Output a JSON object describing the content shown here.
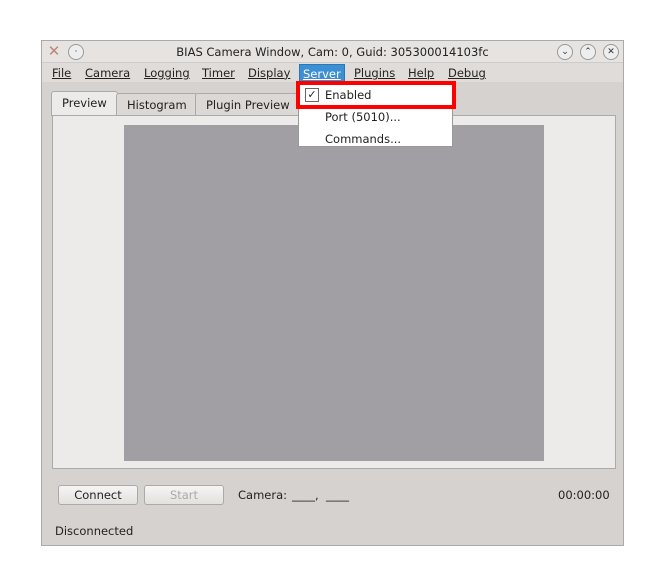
{
  "window": {
    "title": "BIAS Camera Window, Cam: 0, Guid: 305300014103fc"
  },
  "menubar": {
    "items": [
      "File",
      "Camera",
      "Logging",
      "Timer",
      "Display",
      "Server",
      "Plugins",
      "Help",
      "Debug"
    ],
    "active": "Server"
  },
  "server_menu": {
    "items": [
      {
        "label": "Enabled",
        "checked": true
      },
      {
        "label": "Port (5010)..."
      },
      {
        "label": "Commands..."
      }
    ]
  },
  "tabs": [
    {
      "label": "Preview",
      "selected": true
    },
    {
      "label": "Histogram"
    },
    {
      "label": "Plugin Preview"
    }
  ],
  "controls": {
    "connect": "Connect",
    "start": "Start",
    "camera_label": "Camera:",
    "camera_value": "____,  ____",
    "timer": "00:00:00"
  },
  "status": "Disconnected",
  "colors": {
    "highlight": "#3c8fd2",
    "annotation": "#ff0000",
    "preview_bg": "#a19fa3"
  }
}
